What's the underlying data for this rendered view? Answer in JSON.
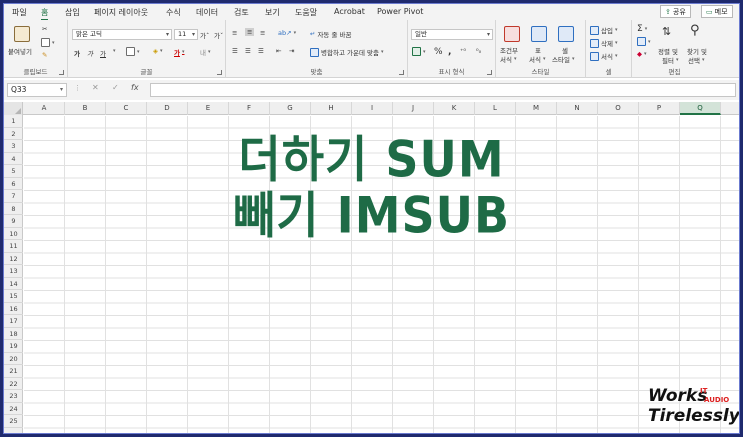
{
  "menu": {
    "tabs": [
      "파일",
      "홈",
      "삽입",
      "페이지 레이아웃",
      "수식",
      "데이터",
      "검토",
      "보기",
      "도움말",
      "Acrobat",
      "Power Pivot"
    ],
    "active_tab": "홈",
    "share_label": "공유",
    "comment_label": "메모"
  },
  "ribbon": {
    "clipboard": {
      "paste_label": "붙여넣기",
      "group_label": "클립보드"
    },
    "font": {
      "font_name": "맑은 고딕",
      "font_size": "11",
      "group_label": "글꼴"
    },
    "alignment": {
      "wrap_text_label": "자동 줄 바꿈",
      "merge_center_label": "병합하고 가운데 맞춤",
      "group_label": "맞춤"
    },
    "number": {
      "format_value": "일반",
      "group_label": "표시 형식"
    },
    "styles": {
      "conditional_label_1": "조건부",
      "conditional_label_2": "서식",
      "table_label_1": "표",
      "table_label_2": "서식",
      "cell_style_label_1": "셀",
      "cell_style_label_2": "스타일",
      "group_label": "스타일"
    },
    "cells": {
      "insert_label": "삽입",
      "delete_label": "삭제",
      "format_label": "서식",
      "group_label": "셀"
    },
    "editing": {
      "sort_label_1": "정렬 및",
      "sort_label_2": "필터",
      "find_label_1": "찾기 및",
      "find_label_2": "선택",
      "group_label": "편집"
    }
  },
  "formula_bar": {
    "name_box": "Q33",
    "fx_label": "fx",
    "cancel_symbol": "✕",
    "enter_symbol": "✓",
    "formula": ""
  },
  "grid": {
    "columns": [
      "A",
      "B",
      "C",
      "D",
      "E",
      "F",
      "G",
      "H",
      "I",
      "J",
      "K",
      "L",
      "M",
      "N",
      "O",
      "P",
      "Q"
    ],
    "selected_column": "Q",
    "rows": [
      "1",
      "2",
      "3",
      "4",
      "5",
      "6",
      "7",
      "8",
      "9",
      "10",
      "11",
      "12",
      "13",
      "14",
      "15",
      "16",
      "17",
      "18",
      "19",
      "20",
      "21",
      "22",
      "23",
      "24",
      "25"
    ]
  },
  "overlay": {
    "line1": "더하기 SUM",
    "line2": "빼기 IMSUB",
    "color": "#1e6b46"
  },
  "watermark": {
    "works": "Works",
    "it": "IT",
    "audio": "AUDIO",
    "tirelessly": "Tirelessly"
  }
}
